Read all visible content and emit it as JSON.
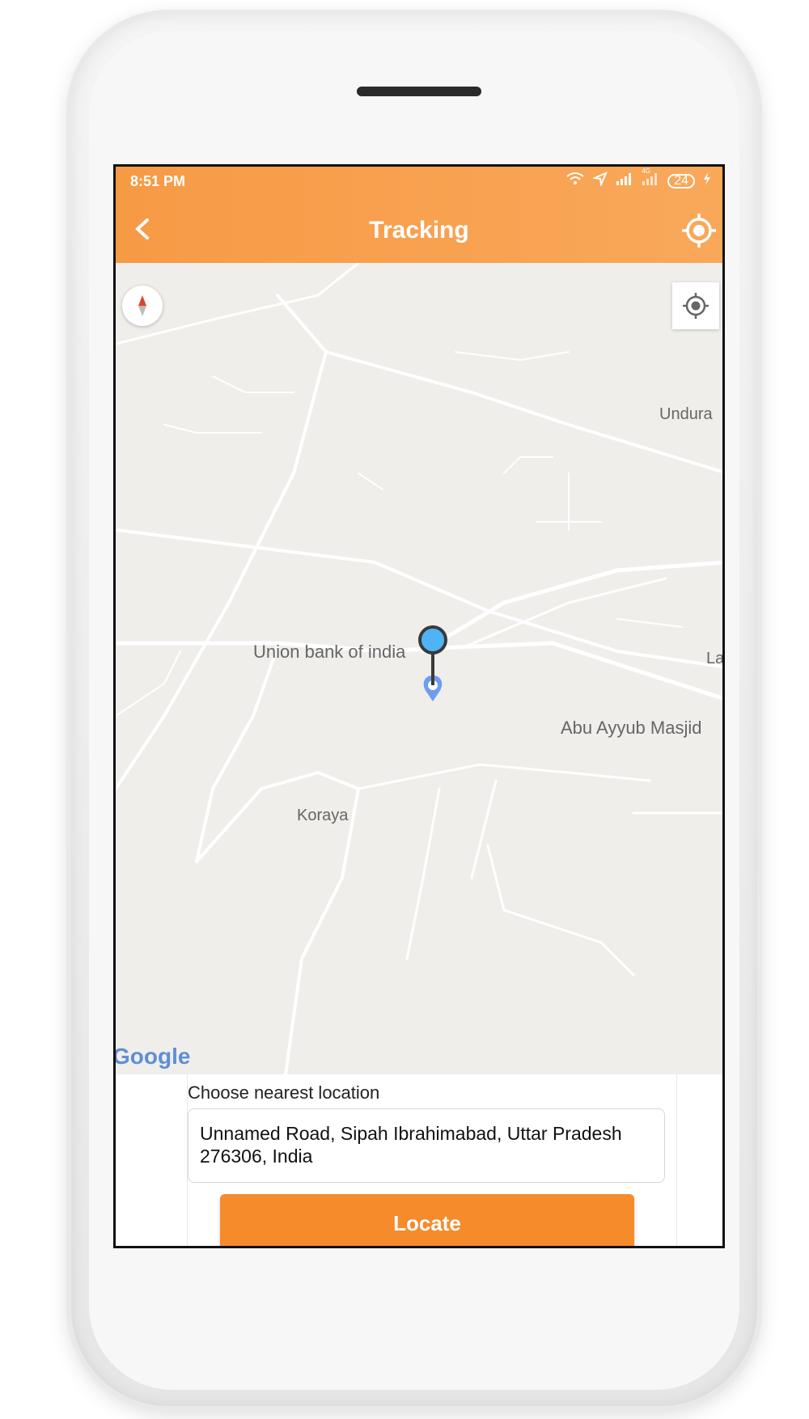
{
  "status_bar": {
    "time": "8:51 PM",
    "network_badge": "4G",
    "battery_level": "24"
  },
  "header": {
    "title": "Tracking",
    "back_icon": "chevron-left-icon",
    "action_icon": "gps-target-icon"
  },
  "map": {
    "labels": {
      "undura": "Undura",
      "union_bank": "Union bank of india",
      "la": "La",
      "abu_ayyub": "Abu Ayyub Masjid",
      "koraya": "Koraya"
    },
    "attribution": "Google",
    "compass_icon": "compass-icon",
    "my_location_icon": "my-location-icon",
    "marker_icon": "map-pin-icon"
  },
  "panel": {
    "label": "Choose nearest location",
    "address": "Unnamed Road, Sipah Ibrahimabad, Uttar Pradesh 276306, India",
    "locate_label": "Locate"
  },
  "colors": {
    "accent": "#f58b2b",
    "header": "#f79a45",
    "marker": "#4fb3f6",
    "map_bg": "#efeeeb"
  }
}
